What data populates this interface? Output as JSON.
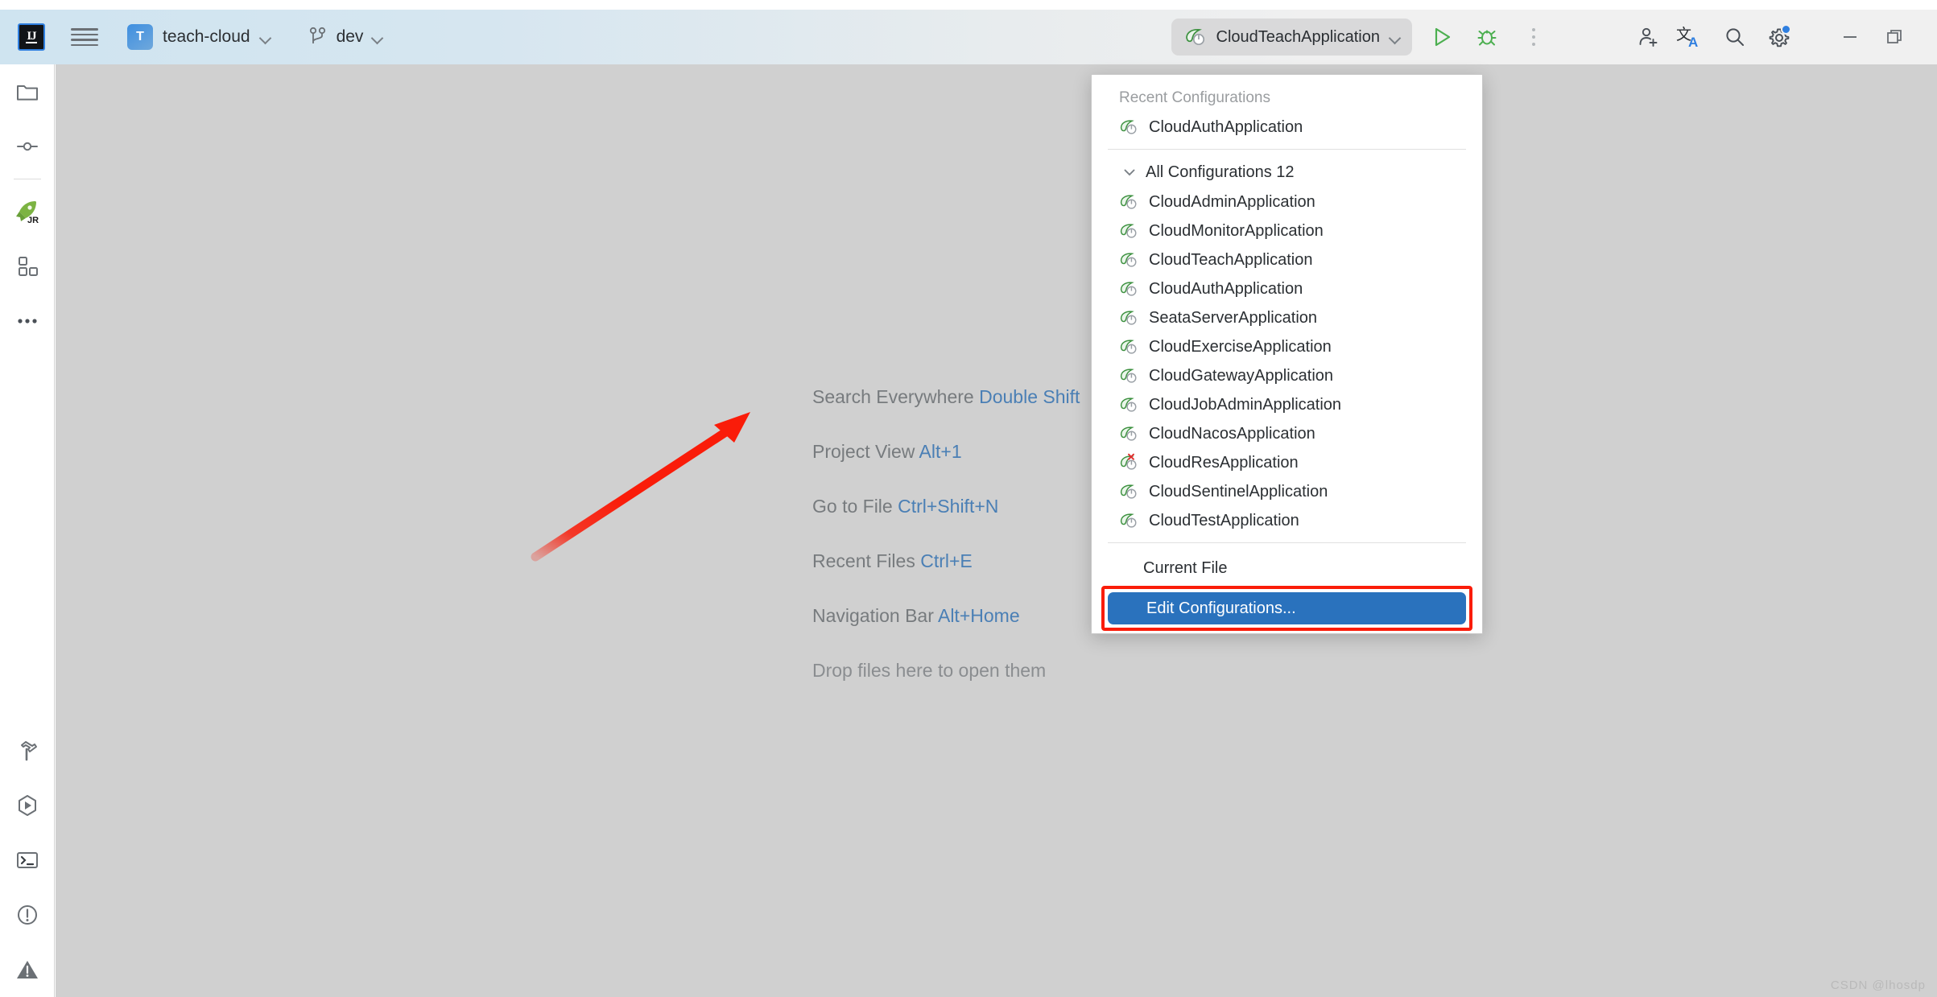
{
  "app": {
    "logo_text": "IJ"
  },
  "toolbar": {
    "menu_icon": "hamburger-icon",
    "project_badge": "T",
    "project_name": "teach-cloud",
    "branch_icon": "git-branch-icon",
    "branch_name": "dev",
    "run_config_name": "CloudTeachApplication",
    "run_icon": "run-play-icon",
    "debug_icon": "debug-bug-icon",
    "more_icon": "more-vertical-icon",
    "share_icon": "add-user-icon",
    "translate_icon": "translate-icon",
    "search_icon": "search-icon",
    "settings_icon": "gear-icon",
    "minimize_icon": "minimize-icon",
    "restore_icon": "restore-window-icon"
  },
  "rail": {
    "top_items": [
      {
        "name": "project-tool-window",
        "icon": "folder-icon"
      },
      {
        "name": "commit-tool-window",
        "icon": "commit-icon"
      }
    ],
    "mid_items": [
      {
        "name": "jrebel-tool-window",
        "icon": "rocket-jr-icon"
      },
      {
        "name": "services-tool-window",
        "icon": "services-squares-icon"
      },
      {
        "name": "more-tool-windows",
        "icon": "ellipsis-icon"
      }
    ],
    "bottom_items": [
      {
        "name": "build-tool-window",
        "icon": "hammer-icon"
      },
      {
        "name": "run-tool-window",
        "icon": "run-hexagon-icon"
      },
      {
        "name": "terminal-tool-window",
        "icon": "terminal-icon"
      },
      {
        "name": "problems-tool-window",
        "icon": "exclamation-circle-icon"
      },
      {
        "name": "warnings-tool-window",
        "icon": "warning-triangle-icon"
      }
    ]
  },
  "editor": {
    "hints": [
      {
        "label": "Search Everywhere",
        "key": "Double Shift"
      },
      {
        "label": "Project View",
        "key": "Alt+1"
      },
      {
        "label": "Go to File",
        "key": "Ctrl+Shift+N"
      },
      {
        "label": "Recent Files",
        "key": "Ctrl+E"
      },
      {
        "label": "Navigation Bar",
        "key": "Alt+Home"
      }
    ],
    "drop_hint": "Drop files here to open them"
  },
  "popup": {
    "recent_section_label": "Recent Configurations",
    "recent_items": [
      {
        "label": "CloudAuthApplication",
        "icon": "spring-boot-leaf-icon",
        "error": false
      }
    ],
    "all_group_label": "All Configurations 12",
    "all_group_count": "12",
    "all_items": [
      {
        "label": "CloudAdminApplication",
        "icon": "spring-boot-leaf-icon",
        "error": false
      },
      {
        "label": "CloudMonitorApplication",
        "icon": "spring-boot-leaf-icon",
        "error": false
      },
      {
        "label": "CloudTeachApplication",
        "icon": "spring-boot-leaf-icon",
        "error": false
      },
      {
        "label": "CloudAuthApplication",
        "icon": "spring-boot-leaf-icon",
        "error": false
      },
      {
        "label": "SeataServerApplication",
        "icon": "spring-boot-leaf-icon",
        "error": false
      },
      {
        "label": "CloudExerciseApplication",
        "icon": "spring-boot-leaf-icon",
        "error": false
      },
      {
        "label": "CloudGatewayApplication",
        "icon": "spring-boot-leaf-icon",
        "error": false
      },
      {
        "label": "CloudJobAdminApplication",
        "icon": "spring-boot-leaf-icon",
        "error": false
      },
      {
        "label": "CloudNacosApplication",
        "icon": "spring-boot-leaf-icon",
        "error": false
      },
      {
        "label": "CloudResApplication",
        "icon": "spring-boot-leaf-icon",
        "error": true
      },
      {
        "label": "CloudSentinelApplication",
        "icon": "spring-boot-leaf-icon",
        "error": false
      },
      {
        "label": "CloudTestApplication",
        "icon": "spring-boot-leaf-icon",
        "error": false
      }
    ],
    "current_file_label": "Current File",
    "edit_configurations_label": "Edit Configurations..."
  },
  "annotation": {
    "highlight_color": "#fa1c09",
    "selected_color": "#2a72bd",
    "arrow_color": "#fa1c09"
  },
  "watermark": "CSDN @lhosdp"
}
